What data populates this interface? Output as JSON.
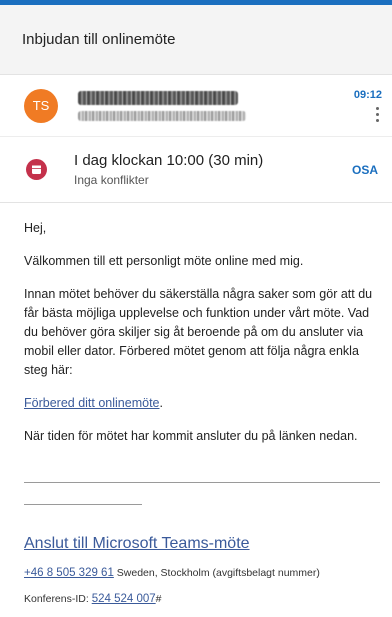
{
  "header": {
    "subject": "Inbjudan till onlinemöte"
  },
  "sender": {
    "initials": "TS",
    "time": "09:12",
    "avatar_color": "#f07b24"
  },
  "event": {
    "title": "I dag klockan 10:00 (30 min)",
    "conflicts": "Inga konflikter",
    "rsvp_label": "OSA",
    "icon_color": "#c4314b"
  },
  "body": {
    "greeting": "Hej,",
    "welcome": "Välkommen till ett personligt möte online med mig.",
    "instructions": "Innan mötet behöver du säkerställa några saker som gör att du får bästa möjliga upplevelse och funktion under vårt möte. Vad du behöver göra skiljer sig åt beroende på om du ansluter via mobil eller dator. Förbered mötet genom att följa några enkla steg här:",
    "prepare_link": "Förbered ditt onlinemöte",
    "prepare_suffix": ".",
    "join_note": "När tiden för mötet har kommit ansluter du på länken nedan."
  },
  "teams": {
    "join_link": "Anslut till Microsoft Teams-möte",
    "phone_number": "+46 8 505 329 61",
    "phone_desc": " Sweden, Stockholm (avgiftsbelagt nummer)",
    "conf_label": "Konferens-ID: ",
    "conf_id": "524 524 007",
    "conf_suffix": "#"
  },
  "colors": {
    "accent": "#1b6fbf",
    "link": "#3a5a9a"
  }
}
